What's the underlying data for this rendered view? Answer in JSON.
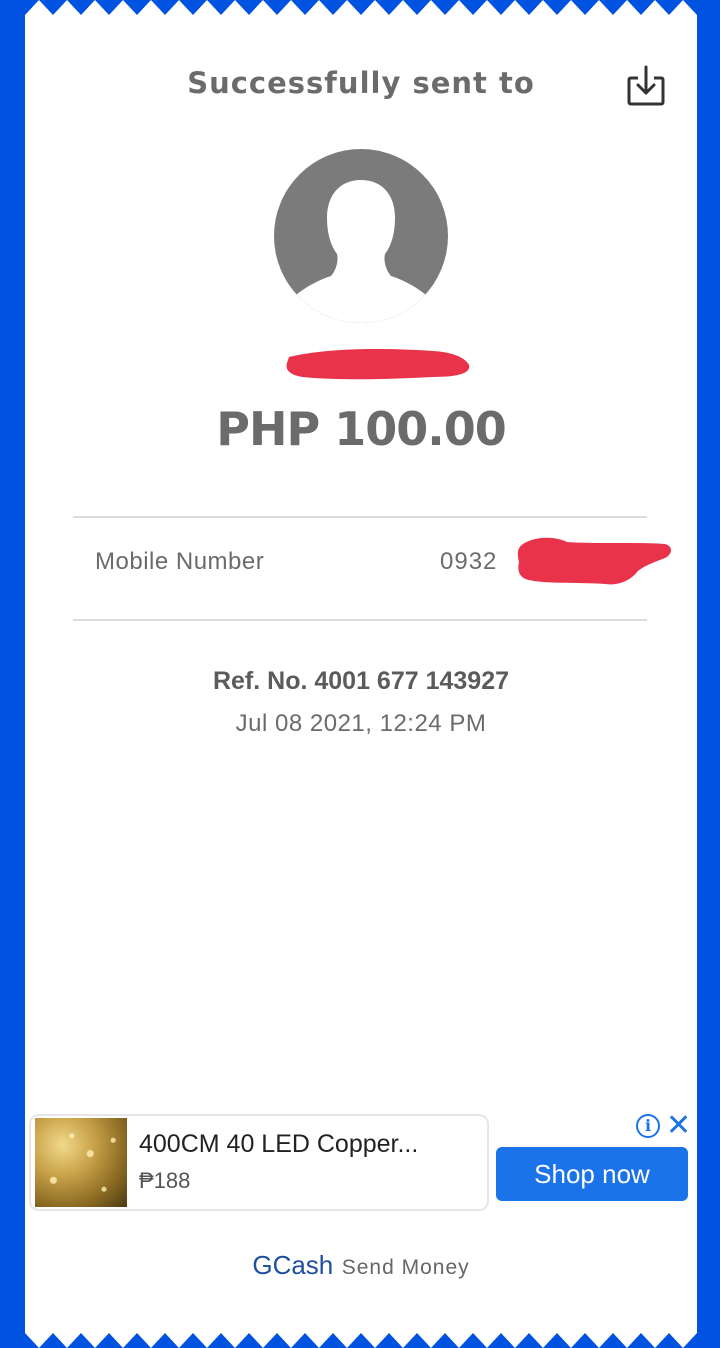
{
  "header": {
    "title": "Successfully sent to",
    "download_icon": "download-icon"
  },
  "recipient": {
    "avatar_icon": "person-avatar-icon"
  },
  "transaction": {
    "amount": "PHP 100.00",
    "mobile_label": "Mobile Number",
    "mobile_value": "0932",
    "ref_no": "Ref. No. 4001 677 143927",
    "datetime": "Jul 08 2021, 12:24 PM"
  },
  "ad": {
    "title": "400CM 40 LED Copper...",
    "price": "₱188",
    "cta": "Shop now",
    "info_icon": "info-icon",
    "close_icon": "close-icon",
    "info_glyph": "i",
    "close_glyph": "✕"
  },
  "footer": {
    "brand": "GCash",
    "label": "Send Money"
  },
  "colors": {
    "background": "#0052e0",
    "text_gray": "#6b6b6b",
    "ad_blue": "#1a73e8",
    "redaction": "#e8334a"
  }
}
